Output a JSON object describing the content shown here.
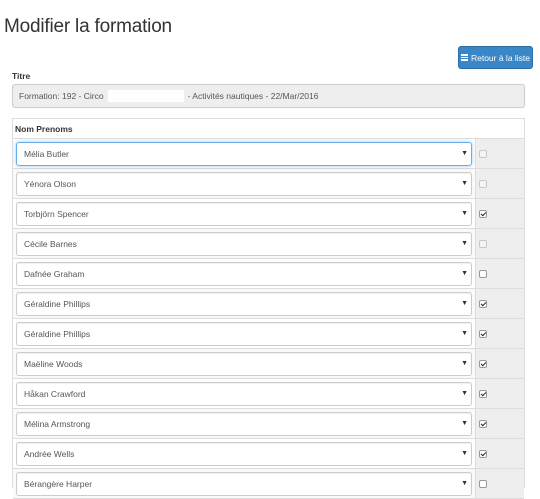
{
  "page": {
    "title": "Modifier la formation"
  },
  "toolbar": {
    "back_label": "Retour à la liste"
  },
  "form": {
    "title_label": "Titre",
    "title_value_prefix": "Formation: 192 - Circo",
    "title_value_suffix": "- Activités nautiques - 22/Mar/2016"
  },
  "participants": {
    "header": "Nom Prenoms",
    "rows": [
      {
        "name": "Mélia Butler",
        "checked": false,
        "disabled": true,
        "focused": true
      },
      {
        "name": "Yénora Olson",
        "checked": false,
        "disabled": true
      },
      {
        "name": "Torbjörn Spencer",
        "checked": true
      },
      {
        "name": "Cécile Barnes",
        "checked": false,
        "disabled": true
      },
      {
        "name": "Dafnée Graham",
        "checked": false
      },
      {
        "name": "Géraldine Phillips",
        "checked": true
      },
      {
        "name": "Géraldine Phillips",
        "checked": true
      },
      {
        "name": "Maëline Woods",
        "checked": true
      },
      {
        "name": "Håkan Crawford",
        "checked": true
      },
      {
        "name": "Mélina Armstrong",
        "checked": true
      },
      {
        "name": "Andrée Wells",
        "checked": true
      },
      {
        "name": "Bérangère Harper",
        "checked": false
      }
    ]
  }
}
